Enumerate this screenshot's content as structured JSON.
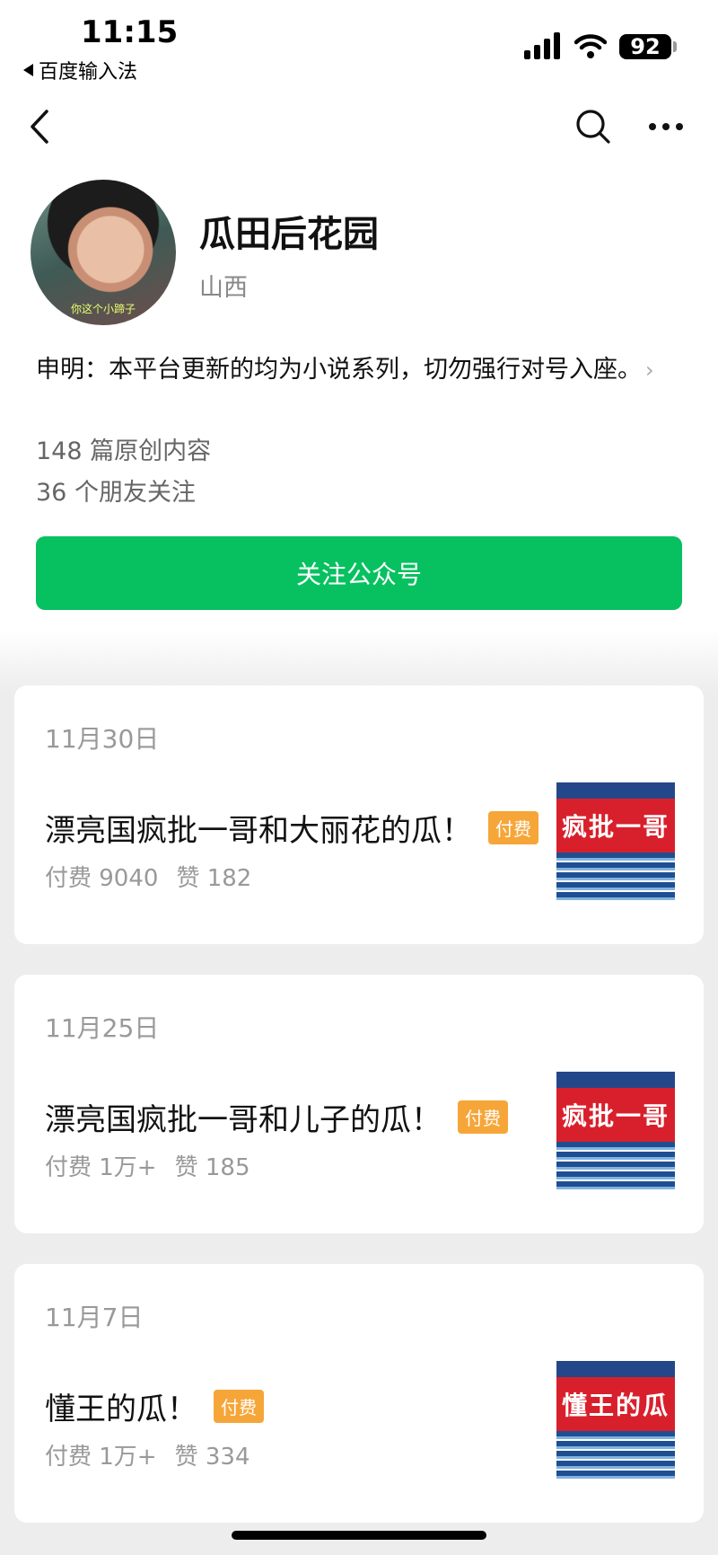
{
  "status_bar": {
    "time": "11:15",
    "back_app": "百度输入法",
    "battery": "92"
  },
  "profile": {
    "name": "瓜田后花园",
    "region": "山西",
    "avatar_caption": "你这个小蹄子",
    "description": "申明：本平台更新的均为小说系列，切勿强行对号入座。",
    "articles_count": "148 篇原创内容",
    "friends_following": "36 个朋友关注",
    "follow_button": "关注公众号"
  },
  "articles": [
    {
      "date": "11月30日",
      "title": "漂亮国疯批一哥和大丽花的瓜！",
      "badge": "付费",
      "paid": "付费 9040",
      "likes": "赞 182",
      "thumb_text": "疯批一哥"
    },
    {
      "date": "11月25日",
      "title": "漂亮国疯批一哥和儿子的瓜！",
      "badge": "付费",
      "paid": "付费 1万+",
      "likes": "赞 185",
      "thumb_text": "疯批一哥"
    },
    {
      "date": "11月7日",
      "title": "懂王的瓜！",
      "badge": "付费",
      "paid": "付费 1万+",
      "likes": "赞 334",
      "thumb_text": "懂王的瓜"
    }
  ],
  "colors": {
    "accent": "#07c160",
    "badge": "#f6a638",
    "background": "#ededed"
  }
}
